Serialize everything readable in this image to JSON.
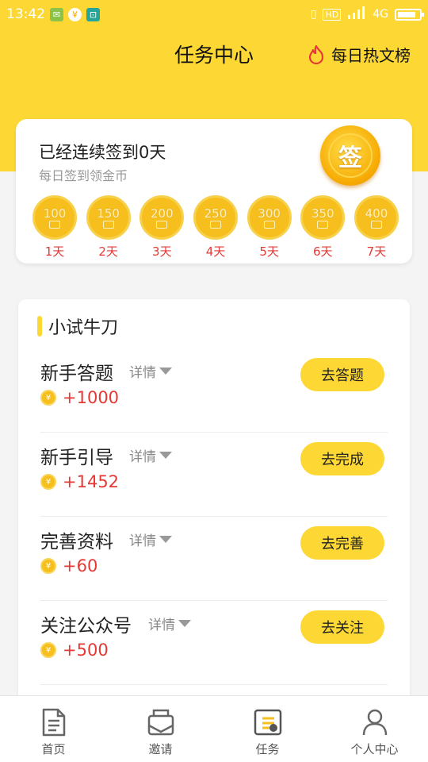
{
  "status_bar": {
    "time": "13:42",
    "network": "4G",
    "hd_label": "HD",
    "battery_level": 0.85
  },
  "header": {
    "title": "任务中心",
    "hot_link": "每日热文榜",
    "background_color": "#fdd835"
  },
  "signin": {
    "title": "已经连续签到0天",
    "subtitle": "每日签到领金币",
    "badge_text": "签",
    "days": [
      {
        "amount": "100",
        "label": "1天"
      },
      {
        "amount": "150",
        "label": "2天"
      },
      {
        "amount": "200",
        "label": "3天"
      },
      {
        "amount": "250",
        "label": "4天"
      },
      {
        "amount": "300",
        "label": "5天"
      },
      {
        "amount": "350",
        "label": "6天"
      },
      {
        "amount": "400",
        "label": "7天"
      }
    ]
  },
  "tasks_section": {
    "title": "小试牛刀",
    "detail_label": "详情",
    "coin_symbol": "¥",
    "items": [
      {
        "name": "新手答题",
        "reward": "+1000",
        "button": "去答题"
      },
      {
        "name": "新手引导",
        "reward": "+1452",
        "button": "去完成"
      },
      {
        "name": "完善资料",
        "reward": "+60",
        "button": "去完善"
      },
      {
        "name": "关注公众号",
        "reward": "+500",
        "button": "去关注"
      }
    ]
  },
  "tabbar": {
    "items": [
      {
        "label": "首页",
        "icon": "document-icon"
      },
      {
        "label": "邀请",
        "icon": "envelope-icon"
      },
      {
        "label": "任务",
        "icon": "task-list-icon"
      },
      {
        "label": "个人中心",
        "icon": "person-icon"
      }
    ]
  },
  "colors": {
    "accent": "#fdd835",
    "reward_red": "#e53935",
    "coin_gold": "#f6bf1e"
  }
}
